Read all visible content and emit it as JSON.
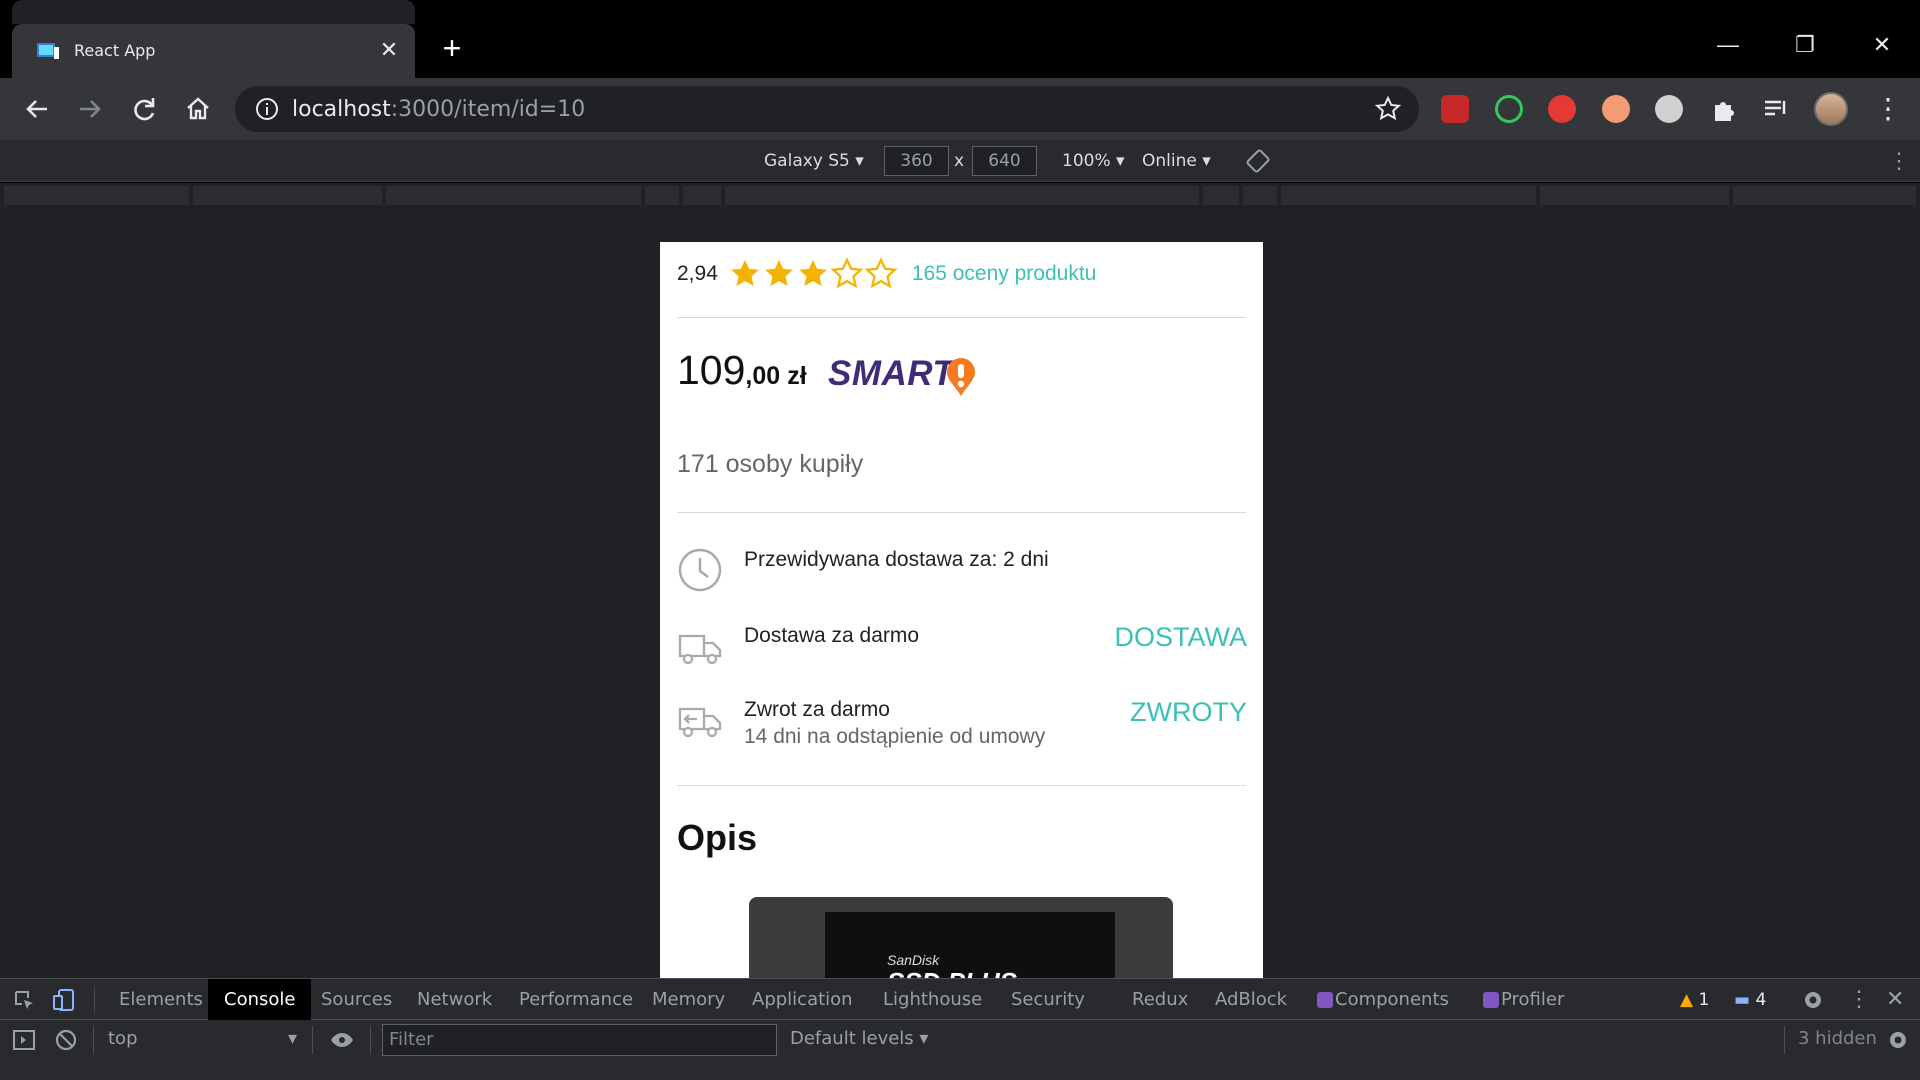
{
  "browser": {
    "tab_title": "React App",
    "url_host": "localhost",
    "url_rest": ":3000/item/id=10"
  },
  "device_toolbar": {
    "device": "Galaxy S5",
    "width": "360",
    "times": "x",
    "height": "640",
    "zoom": "100%",
    "network": "Online"
  },
  "product": {
    "rating_value": "2,94",
    "rating_stars": 3,
    "rating_max": 5,
    "ratings_link": "165 oceny produktu",
    "price_int": "109",
    "price_dec": ",00",
    "currency": "zł",
    "smart_label": "SMART",
    "bought": "171 osoby kupiły",
    "delivery_estimate": "Przewidywana dostawa za: 2 dni",
    "free_delivery": "Dostawa za darmo",
    "delivery_link": "DOSTAWA",
    "free_return": "Zwrot za darmo",
    "return_detail": "14 dni na odstąpienie od umowy",
    "returns_link": "ZWROTY",
    "description_heading": "Opis",
    "image_brand": "SanDisk",
    "image_model": "SSD PLUS"
  },
  "devtools": {
    "tabs": [
      "Elements",
      "Console",
      "Sources",
      "Network",
      "Performance",
      "Memory",
      "Application",
      "Lighthouse",
      "Security",
      "Redux",
      "AdBlock",
      "Components",
      "Profiler"
    ],
    "active_tab": "Console",
    "warnings": "1",
    "messages": "4",
    "context": "top",
    "filter_placeholder": "Filter",
    "levels": "Default levels",
    "hidden": "3 hidden"
  },
  "colors": {
    "accent": "#3cc0b6",
    "smart_purple": "#3f2b76",
    "smart_orange": "#f47b20",
    "star": "#f5b301"
  }
}
